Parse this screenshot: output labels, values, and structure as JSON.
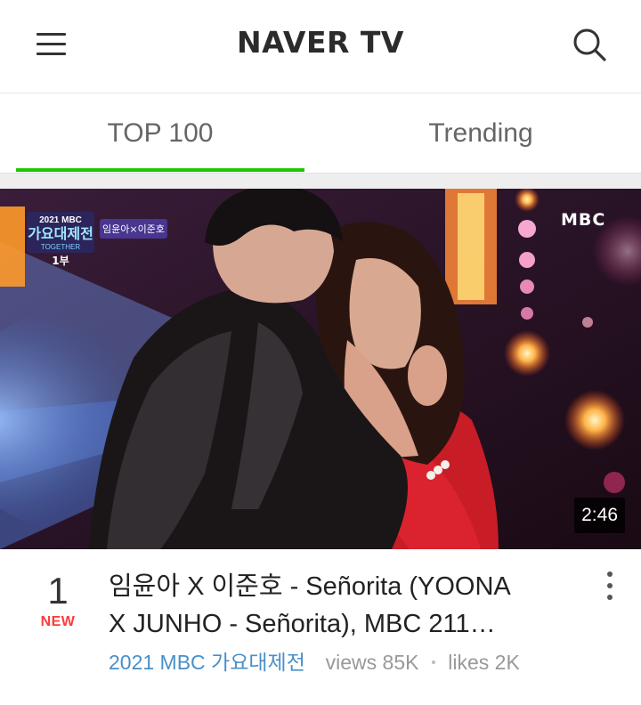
{
  "header": {
    "logo_text": "NAVER TV",
    "menu_icon": "hamburger-menu-icon",
    "search_icon": "search-icon"
  },
  "tabs": [
    {
      "label": "TOP 100",
      "active": true
    },
    {
      "label": "Trending",
      "active": false
    }
  ],
  "colors": {
    "accent": "#1ec800",
    "new_badge": "#ff3a3a",
    "channel": "#4a8fc8"
  },
  "video": {
    "rank": "1",
    "badge": "NEW",
    "title_line1": "임윤아 X 이준호 - Señorita (YOONA",
    "title_line2": "X JUNHO - Señorita), MBC 211…",
    "channel": "2021 MBC 가요대제전",
    "views": "views 85K",
    "likes": "likes 2K",
    "duration": "2:46",
    "overlay_logo": "MBC",
    "overlay_show_caption": "임윤아×이준호",
    "overlay_part": "1부"
  }
}
